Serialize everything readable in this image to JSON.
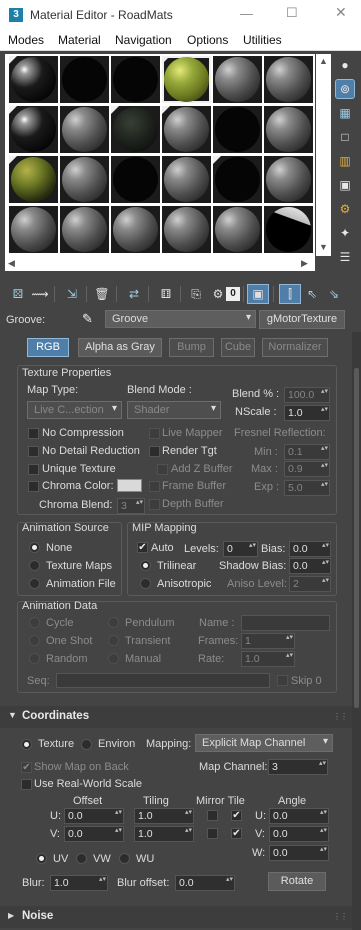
{
  "window": {
    "title": "Material Editor - RoadMats",
    "app_icon": "3"
  },
  "menu": [
    "Modes",
    "Material",
    "Navigation",
    "Options",
    "Utilities"
  ],
  "slots": [
    [
      "gloss-black",
      "black",
      "black",
      "grass",
      "gray",
      "gray"
    ],
    [
      "gloss-black",
      "gray",
      "noisy-dark",
      "gray",
      "black",
      "gray"
    ],
    [
      "grass-dark",
      "gray",
      "black",
      "gray",
      "black",
      "gray"
    ],
    [
      "gray",
      "gray",
      "gray",
      "gray",
      "gray",
      "half-white"
    ]
  ],
  "toolbar_icons": [
    "get-material-icon",
    "put-to-scene-icon",
    "assign-material-icon",
    "reset-icon",
    "copy-material-icon",
    "make-unique-icon",
    "put-to-library-icon",
    "material-id-icon",
    "show-shaded-icon",
    "show-end-result-icon",
    "go-to-parent-icon",
    "go-forward-sibling-icon"
  ],
  "toolbar_material_id": "0",
  "name_row": {
    "label": "Groove:",
    "material_name": "Groove",
    "type_button": "gMotorTexture"
  },
  "texture_tabs": [
    "RGB",
    "Alpha as Gray",
    "Bump",
    "Cube",
    "Normalizer"
  ],
  "texture_properties": {
    "title": "Texture Properties",
    "map_type_label": "Map Type:",
    "map_type_value": "Live C...ection",
    "blend_mode_label": "Blend Mode :",
    "blend_mode_value": "Shader",
    "blend_pct_label": "Blend % :",
    "blend_pct_value": "100.0",
    "nscale_label": "NScale :",
    "nscale_value": "1.0",
    "no_compression": "No Compression",
    "no_detail_reduction": "No Detail Reduction",
    "unique_texture": "Unique Texture",
    "chroma_color": "Chroma Color:",
    "chroma_blend": "Chroma Blend:",
    "chroma_blend_value": "3",
    "live_mapper": "Live Mapper",
    "render_tgt": "Render Tgt",
    "add_z_buffer": "Add Z Buffer",
    "frame_buffer": "Frame Buffer",
    "depth_buffer": "Depth Buffer",
    "fresnel_title": "Fresnel Reflection:",
    "fresnel_min_label": "Min :",
    "fresnel_min": "0.1",
    "fresnel_max_label": "Max :",
    "fresnel_max": "0.9",
    "fresnel_exp_label": "Exp :",
    "fresnel_exp": "5.0"
  },
  "animation_source": {
    "title": "Animation Source",
    "options": [
      "None",
      "Texture Maps",
      "Animation File"
    ],
    "selected": "None"
  },
  "mip_mapping": {
    "title": "MIP Mapping",
    "auto": "Auto",
    "levels_label": "Levels:",
    "levels": "0",
    "bias_label": "Bias:",
    "bias": "0.0",
    "trilinear": "Trilinear",
    "shadow_bias_label": "Shadow Bias:",
    "shadow_bias": "0.0",
    "anisotropic": "Anisotropic",
    "aniso_level_label": "Aniso Level:",
    "aniso_level": "2"
  },
  "animation_data": {
    "title": "Animation Data",
    "left_options": [
      "Cycle",
      "One Shot",
      "Random"
    ],
    "mid_options": [
      "Pendulum",
      "Transient",
      "Manual"
    ],
    "name_label": "Name :",
    "frames_label": "Frames:",
    "frames": "1",
    "rate_label": "Rate:",
    "rate": "1.0",
    "seq_label": "Seq:",
    "skip_label": "Skip 0"
  },
  "coordinates": {
    "title": "Coordinates",
    "texture": "Texture",
    "environ": "Environ",
    "mapping_label": "Mapping:",
    "mapping_value": "Explicit Map Channel",
    "show_map_on_back": "Show Map on Back",
    "map_channel_label": "Map Channel:",
    "map_channel": "3",
    "use_real_world": "Use Real-World Scale",
    "offset": "Offset",
    "tiling": "Tiling",
    "mirror_tile": "Mirror Tile",
    "angle": "Angle",
    "u_label": "U:",
    "v_label": "V:",
    "w_label": "W:",
    "offset_u": "0.0",
    "offset_v": "0.0",
    "tiling_u": "1.0",
    "tiling_v": "1.0",
    "angle_u": "0.0",
    "angle_v": "0.0",
    "angle_w": "0.0",
    "uvw_options": [
      "UV",
      "VW",
      "WU"
    ],
    "blur_label": "Blur:",
    "blur": "1.0",
    "blur_offset_label": "Blur offset:",
    "blur_offset": "0.0",
    "rotate": "Rotate"
  },
  "noise": {
    "title": "Noise"
  }
}
